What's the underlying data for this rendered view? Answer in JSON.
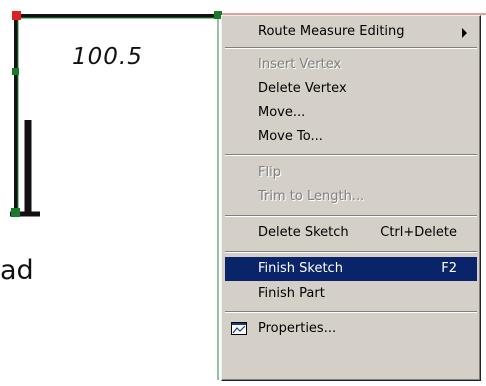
{
  "sketch": {
    "segment_label": "100.5",
    "road_label_fragment": "ad"
  },
  "colors": {
    "menu_background": "#d4d0c8",
    "selection": "#0a246a",
    "vertex": "#1a7a2a",
    "start_vertex": "#e02020",
    "sketch_line": "#111111"
  },
  "context_menu": {
    "route_measure_editing": "Route Measure Editing",
    "insert_vertex": "Insert Vertex",
    "delete_vertex": "Delete Vertex",
    "move": "Move...",
    "move_to": "Move To...",
    "flip": "Flip",
    "trim_to_length": "Trim to Length...",
    "delete_sketch": "Delete Sketch",
    "delete_sketch_shortcut": "Ctrl+Delete",
    "finish_sketch": "Finish Sketch",
    "finish_sketch_shortcut": "F2",
    "finish_part": "Finish Part",
    "properties": "Properties...",
    "properties_icon": "properties-icon"
  }
}
